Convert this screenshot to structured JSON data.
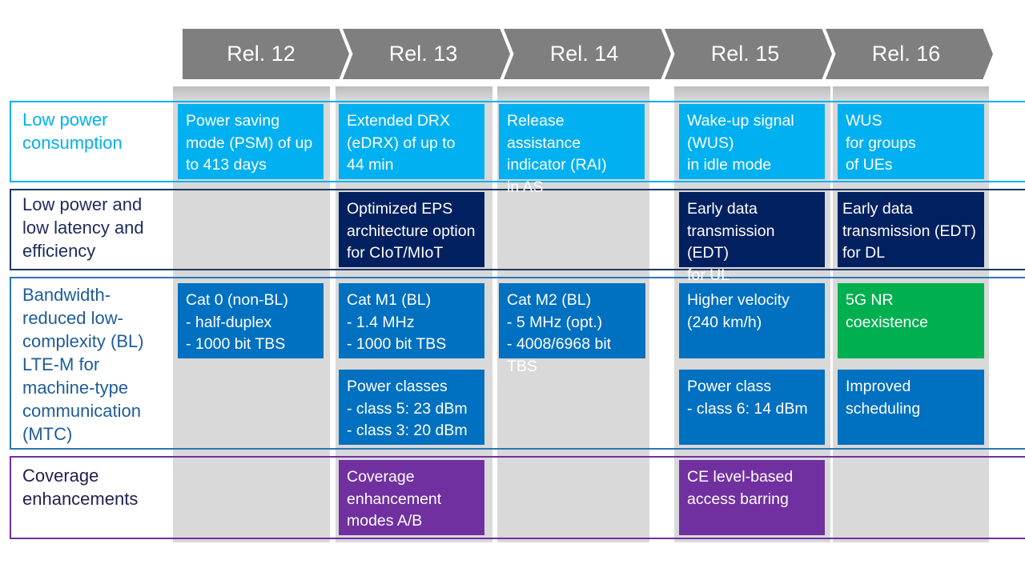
{
  "releases": [
    "Rel. 12",
    "Rel. 13",
    "Rel. 14",
    "Rel. 15",
    "Rel. 16"
  ],
  "colors": {
    "arrow": "#7f7f7f",
    "band": "#d9d9d9",
    "low_power": "#00b0f0",
    "low_latency": "#002060",
    "bandwidth": "#0070c0",
    "coexistence": "#00b050",
    "coverage": "#7030a0"
  },
  "rows": [
    {
      "label": "Low power\nconsumption",
      "cells": {
        "rel12": "Power saving\nmode (PSM) of up\nto 413 days",
        "rel13": "Extended DRX\n(eDRX) of up to\n44 min",
        "rel14": "Release assistance\nindicator (RAI)\nin AS",
        "rel15": "Wake-up signal\n(WUS)\nin idle mode",
        "rel16": "WUS\nfor groups\nof UEs"
      }
    },
    {
      "label": "Low power and\nlow latency and\nefficiency",
      "cells": {
        "rel13": "Optimized EPS\narchitecture option\nfor CIoT/MIoT",
        "rel15": "Early data\ntransmission (EDT)\nfor UL",
        "rel16": "Early data\ntransmission (EDT)\nfor DL"
      }
    },
    {
      "label": "Bandwidth-\nreduced low-\ncomplexity (BL)\nLTE-M for\nmachine-type\ncommunication\n(MTC)",
      "cells": {
        "rel12": "Cat 0 (non-BL)\n- half-duplex\n- 1000 bit TBS",
        "rel13a": "Cat M1 (BL)\n- 1.4 MHz\n- 1000 bit TBS",
        "rel13b": "Power classes\n- class 5: 23 dBm\n- class 3: 20 dBm",
        "rel14": "Cat M2 (BL)\n- 5 MHz (opt.)\n- 4008/6968 bit TBS",
        "rel15a": "Higher velocity\n(240 km/h)",
        "rel15b": "Power class\n- class 6: 14 dBm",
        "rel16a": "5G NR\ncoexistence",
        "rel16b": "Improved\nscheduling"
      }
    },
    {
      "label": "Coverage\nenhancements",
      "cells": {
        "rel13": "Coverage\nenhancement\nmodes A/B",
        "rel15": "CE level-based\naccess barring"
      }
    }
  ]
}
